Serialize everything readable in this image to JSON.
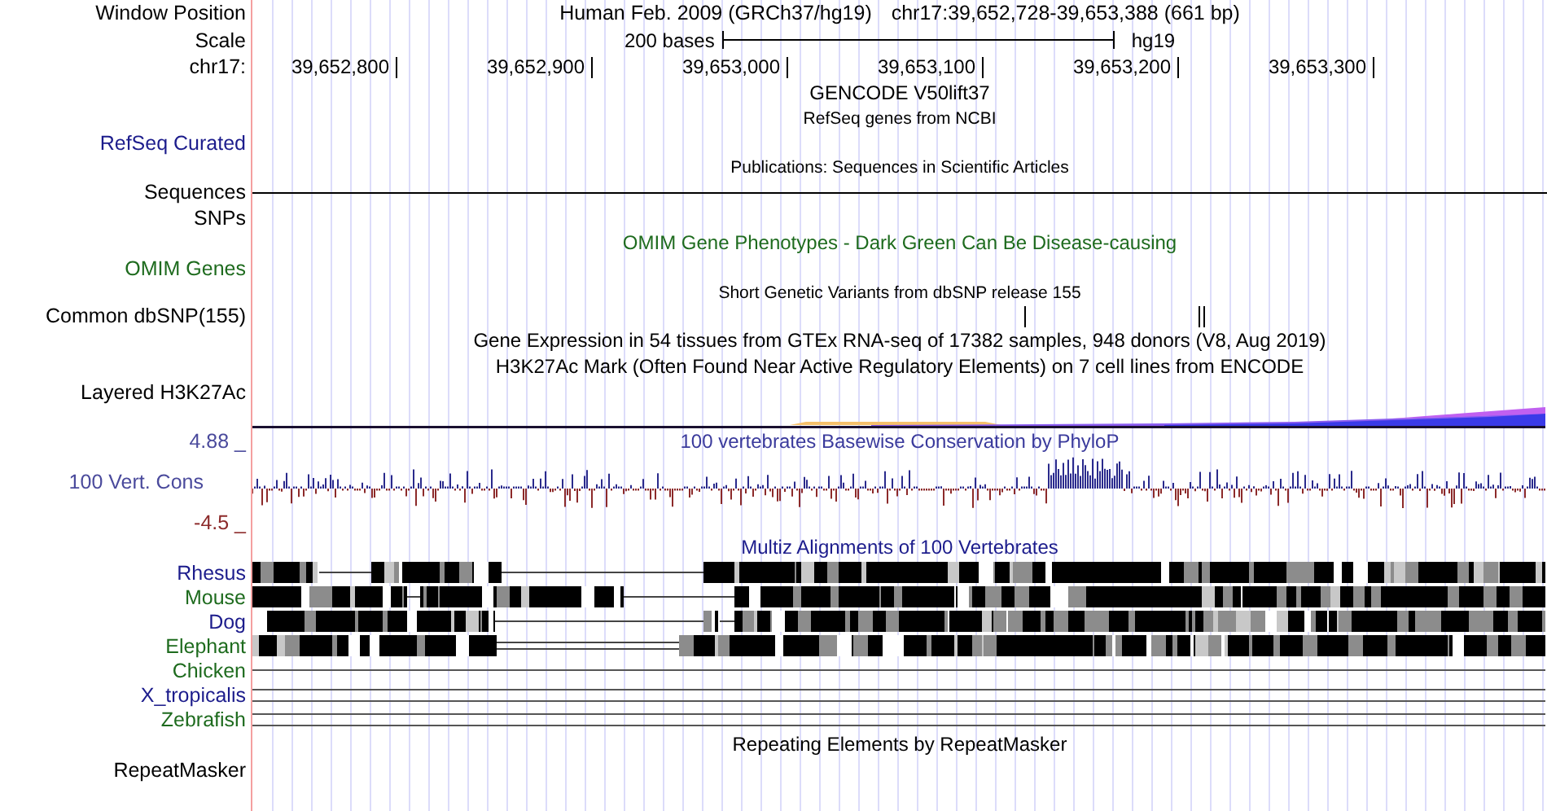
{
  "window_position": {
    "label": "Window Position",
    "assembly": "Human Feb. 2009 (GRCh37/hg19)",
    "position": "chr17:39,652,728-39,653,388 (661 bp)"
  },
  "scale": {
    "label": "Scale",
    "length": "200 bases",
    "assembly": "hg19"
  },
  "ruler": {
    "label": "chr17:",
    "ticks": [
      "39,652,800",
      "39,652,900",
      "39,653,000",
      "39,653,100",
      "39,653,200",
      "39,653,300"
    ]
  },
  "rows": [
    {
      "kind": "title",
      "text": "GENCODE V50lift37"
    },
    {
      "kind": "subtitle",
      "text": "RefSeq genes from NCBI"
    },
    {
      "kind": "label",
      "label": "RefSeq Curated",
      "color": "#1c1c8c"
    },
    {
      "kind": "subtitle",
      "text": "Publications: Sequences in Scientific Articles"
    },
    {
      "kind": "sequence",
      "label": "Sequences"
    },
    {
      "kind": "label",
      "label": "SNPs"
    },
    {
      "kind": "title",
      "text": "OMIM Gene Phenotypes - Dark Green Can Be Disease-causing",
      "color": "#1e6b1e"
    },
    {
      "kind": "label",
      "label": "OMIM Genes",
      "color": "#1e6b1e"
    },
    {
      "kind": "subtitle",
      "text": "Short Genetic Variants from dbSNP release 155"
    },
    {
      "kind": "variants",
      "label": "Common dbSNP(155)"
    },
    {
      "kind": "title",
      "text": "Gene Expression in 54 tissues from GTEx RNA-seq of 17382 samples, 948 donors (V8, Aug 2019)"
    },
    {
      "kind": "title",
      "text": "H3K27Ac Mark (Often Found Near Active Regulatory Elements) on 7 cell lines from ENCODE"
    },
    {
      "kind": "label",
      "label": "Layered H3K27Ac"
    },
    {
      "kind": "signal"
    },
    {
      "kind": "conservation",
      "title": "100 vertebrates Basewise Conservation by PhyloP",
      "label": "100 Vert. Cons",
      "max": "4.88 _",
      "min": "-4.5 _"
    },
    {
      "kind": "title",
      "text": "Multiz Alignments of 100 Vertebrates",
      "color": "#1c1c8c"
    },
    {
      "kind": "alignment",
      "label": "Rhesus",
      "color": "#1c1c8c"
    },
    {
      "kind": "alignment",
      "label": "Mouse",
      "color": "#1e6b1e"
    },
    {
      "kind": "alignment",
      "label": "Dog",
      "color": "#1c1c8c"
    },
    {
      "kind": "alignment",
      "label": "Elephant",
      "color": "#1e6b1e"
    },
    {
      "kind": "single_line",
      "label": "Chicken",
      "color": "#1e6b1e"
    },
    {
      "kind": "double_line",
      "label": "X_tropicalis",
      "color": "#1c1c8c"
    },
    {
      "kind": "double_line",
      "label": "Zebrafish",
      "color": "#1e6b1e"
    },
    {
      "kind": "title",
      "text": "Repeating Elements by RepeatMasker"
    },
    {
      "kind": "label",
      "label": "RepeatMasker"
    }
  ]
}
